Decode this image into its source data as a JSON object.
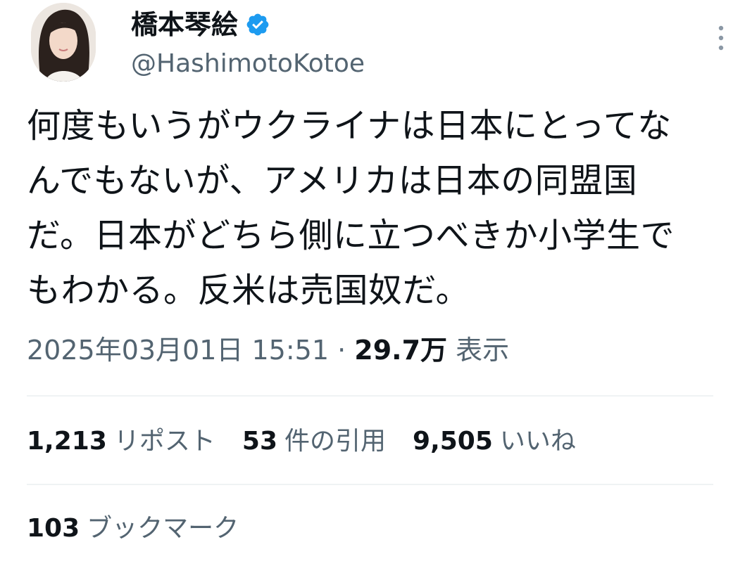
{
  "author": {
    "display_name": "橋本琴絵",
    "handle": "@HashimotoKotoe",
    "verified_icon": "verified-badge-icon",
    "verified_color": "#1d9bf0"
  },
  "tweet": {
    "text": "何度もいうがウクライナは日本にとってな\nんでもないが、アメリカは日本の同盟国\nだ。日本がどちら側に立つべきか小学生で\nもわかる。反米は売国奴だ。"
  },
  "meta": {
    "timestamp": "2025年03月01日 15:51",
    "separator": "·",
    "views_count": "29.7万",
    "views_label": "表示"
  },
  "stats": {
    "reposts_count": "1,213",
    "reposts_label": "リポスト",
    "quotes_count": "53",
    "quotes_label": "件の引用",
    "likes_count": "9,505",
    "likes_label": "いいね",
    "bookmarks_count": "103",
    "bookmarks_label": "ブックマーク"
  },
  "colors": {
    "primary_text": "#0f1419",
    "secondary_text": "#536471",
    "divider": "#eff3f4"
  }
}
